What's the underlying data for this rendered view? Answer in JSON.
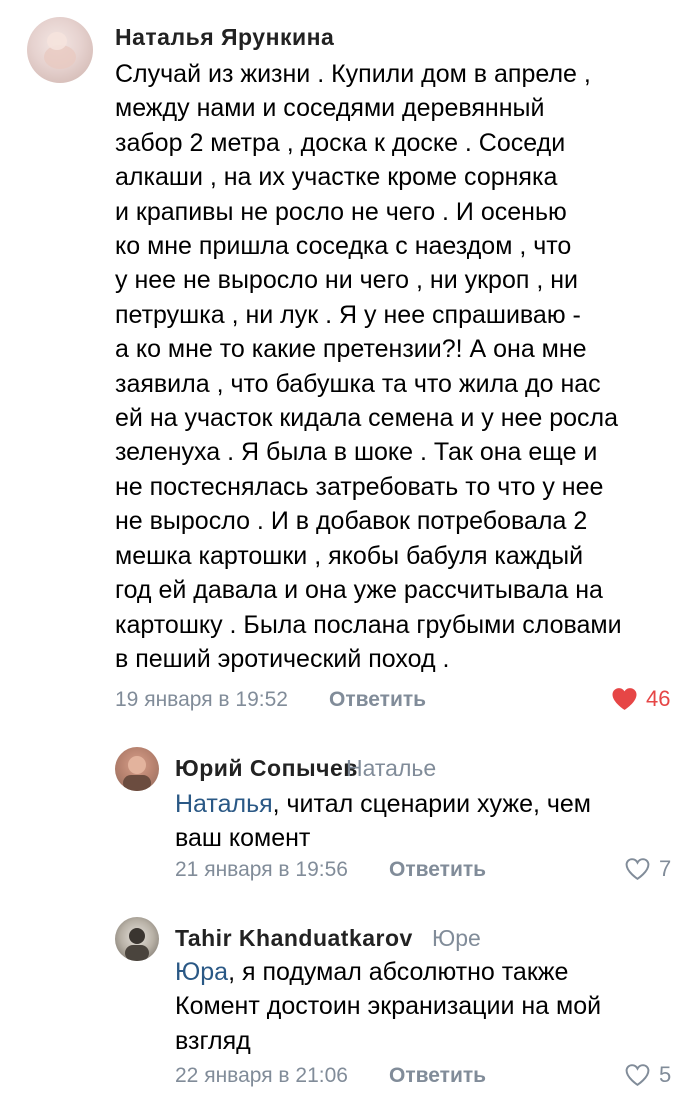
{
  "comments": [
    {
      "author": "Наталья Ярункина",
      "text": "Случай из жизни . Купили дом в апреле ,\nмежду нами и соседями деревянный\nзабор 2 метра , доска к доске . Соседи\nалкаши , на их участке кроме сорняка\nи крапивы не росло не чего . И осенью\nко мне пришла соседка с наездом , что\nу нее не выросло ни чего , ни укроп , ни\nпетрушка , ни лук . Я у нее спрашиваю -\nа ко мне то какие претензии?! А она мне\nзаявила , что бабушка та что жила до нас\nей на участок кидала семена и у нее росла\nзеленуха . Я  была в шоке . Так она еще и\nне постеснялась затребовать то что у нее\nне выросло . И в добавок потребовала 2\nмешка картошки , якобы бабуля каждый\nгод ей давала и она уже рассчитывала на\nкартошку . Была послана грубыми словами\nв пеший эротический поход .",
      "date": "19 января в 19:52",
      "reply_label": "Ответить",
      "likes": "46",
      "liked": true
    }
  ],
  "replies": [
    {
      "author": "Юрий Сопычев",
      "reply_to": "Наталье",
      "mention": "Наталья",
      "text_after_mention": ", читал сценарии хуже, чем\nваш комент",
      "date": "21 января в 19:56",
      "reply_label": "Ответить",
      "likes": "7",
      "liked": false
    },
    {
      "author": "Tahir Khanduatkarov",
      "reply_to": "Юре",
      "mention": "Юра",
      "text_after_mention": ", я подумал абсолютно также\nКомент достоин экранизации на мой\nвзгляд",
      "date": "22 января в 21:06",
      "reply_label": "Ответить",
      "likes": "5",
      "liked": false
    }
  ],
  "colors": {
    "link": "#2a5885",
    "meta": "#818c99",
    "heart_liked": "#e64646"
  }
}
